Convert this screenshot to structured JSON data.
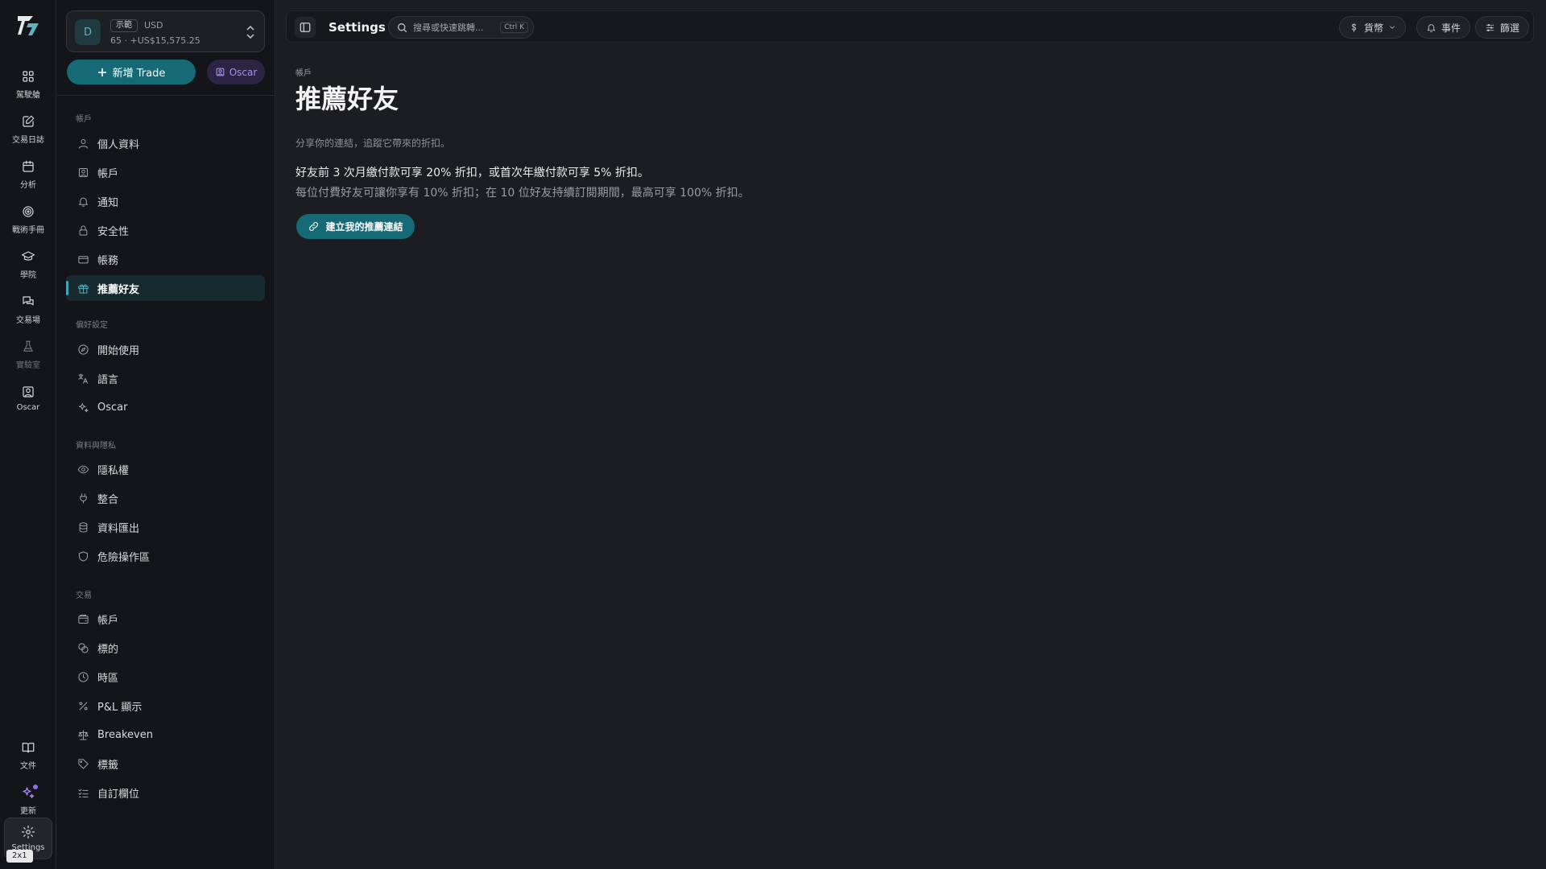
{
  "rail": {
    "items": [
      {
        "label": "駕駛艙",
        "icon": "dashboard-grid-icon"
      },
      {
        "label": "交易日誌",
        "icon": "journal-edit-icon"
      },
      {
        "label": "分析",
        "icon": "calendar-icon"
      },
      {
        "label": "戰術手冊",
        "icon": "target-icon"
      },
      {
        "label": "學院",
        "icon": "graduation-cap-icon"
      },
      {
        "label": "交易場",
        "icon": "chat-bubbles-icon"
      },
      {
        "label": "實驗室",
        "icon": "flask-icon"
      },
      {
        "label": "Oscar",
        "icon": "oscar-portrait-icon"
      }
    ],
    "bottom": [
      {
        "label": "文件",
        "icon": "book-icon"
      },
      {
        "label": "更新",
        "icon": "sparkles-icon"
      },
      {
        "label": "Settings",
        "icon": "gear-icon"
      }
    ],
    "zoom_badge": "2x1"
  },
  "account": {
    "avatar": "D",
    "badge": "示範",
    "currency": "USD",
    "balance": "65 · +US$15,575.25"
  },
  "side_buttons": {
    "new_trade": "新增 Trade",
    "oscar": "Oscar"
  },
  "sidebar": {
    "sections": [
      {
        "title": "帳戶",
        "items": [
          "個人資料",
          "帳戶",
          "通知",
          "安全性",
          "帳務",
          "推薦好友"
        ]
      },
      {
        "title": "偏好設定",
        "items": [
          "開始使用",
          "語言",
          "Oscar"
        ]
      },
      {
        "title": "資料與隱私",
        "items": [
          "隱私權",
          "整合",
          "資料匯出",
          "危險操作區"
        ]
      },
      {
        "title": "交易",
        "items": [
          "帳戶",
          "標的",
          "時區",
          "P&L 顯示",
          "Breakeven",
          "標籤",
          "自訂欄位"
        ]
      }
    ]
  },
  "topbar": {
    "title": "Settings",
    "search_placeholder": "搜尋或快速跳轉...",
    "shortcut": "Ctrl K",
    "currency": "貨幣",
    "events": "事件",
    "filter": "篩選"
  },
  "main": {
    "breadcrumb": "帳戶",
    "title": "推薦好友",
    "subtitle": "分享你的連結，追蹤它帶來的折扣。",
    "line1": "好友前 3 次月繳付款可享 20% 折扣，或首次年繳付款可享 5% 折扣。",
    "line2": "每位付費好友可讓你享有 10% 折扣；在 10 位好友持續訂閱期間，最高可享 100% 折扣。",
    "cta": "建立我的推薦連結"
  }
}
